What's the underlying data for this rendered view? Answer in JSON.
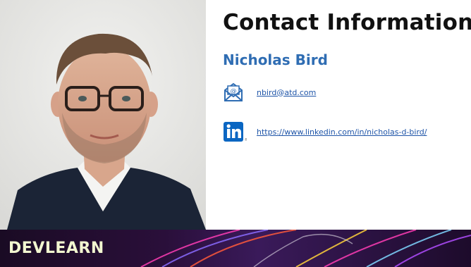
{
  "slide": {
    "title": "Contact Information",
    "name": "Nicholas Bird",
    "email": {
      "text": "nbird@atd.com",
      "icon": "email-envelope-icon"
    },
    "linkedin": {
      "text": "https://www.linkedin.com/in/nicholas-d-bird/",
      "icon": "linkedin-icon"
    }
  },
  "footer": {
    "brand": "DEVLEARN"
  },
  "colors": {
    "title": "#111111",
    "name": "#2f6db3",
    "link": "#1f55a8",
    "linkedin_blue": "#0a66c2",
    "footer_bg": "#1a0b24",
    "brand_text": "#f2f7d0"
  }
}
